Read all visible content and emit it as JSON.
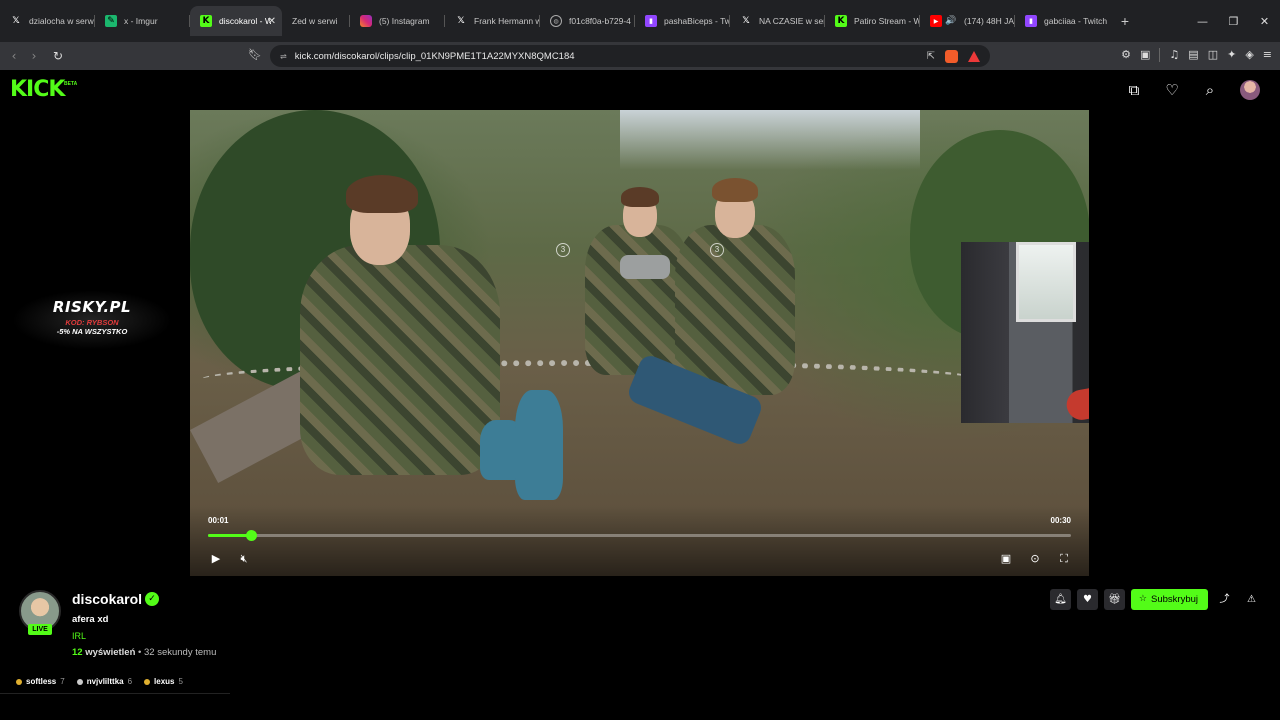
{
  "browser": {
    "tabs": [
      {
        "label": "dzialocha w serw",
        "icon": "x-icon",
        "color": "#ffffff"
      },
      {
        "label": "x - Imgur",
        "icon": "imgur-icon",
        "color": "#1bb76e"
      },
      {
        "label": "discokarol - W",
        "icon": "kick-icon",
        "color": "#53fc18",
        "active": true
      },
      {
        "label": "Zed w serwi",
        "icon": "",
        "color": ""
      },
      {
        "label": "(5) Instagram",
        "icon": "instagram-icon",
        "color": "#d62976"
      },
      {
        "label": "Frank Hermann w",
        "icon": "x-icon",
        "color": "#ffffff"
      },
      {
        "label": "f01c8f0a-b729-4",
        "icon": "globe-icon",
        "color": "#aaaaaa"
      },
      {
        "label": "pashaBiceps - Tw",
        "icon": "twitch-icon",
        "color": "#9146ff"
      },
      {
        "label": "NA CZASIE w serw",
        "icon": "x-icon",
        "color": "#ffffff"
      },
      {
        "label": "Patiro Stream - W",
        "icon": "kick-icon",
        "color": "#53fc18"
      },
      {
        "label": "(174) 48H JAI",
        "icon": "youtube-icon",
        "color": "#ff0000"
      },
      {
        "label": "gabciiaa - Twitch",
        "icon": "twitch-icon",
        "color": "#9146ff"
      }
    ],
    "url": "kick.com/discokarol/clips/clip_01KN9PME1T1A22MYXN8QMC184"
  },
  "kick": {
    "logo": "KICK",
    "beta": "BETA",
    "accent": "#53fc18"
  },
  "ad": {
    "brand": "RISKY.PL",
    "code": "KOD: RYBSON",
    "discount": "-5% NA WSZYSTKO"
  },
  "player": {
    "current_time": "00:01",
    "duration": "00:30",
    "progress": 0.05
  },
  "channel": {
    "name": "discokarol",
    "live_label": "LIVE",
    "clip_title": "afera xd",
    "category": "IRL",
    "views_count": "12",
    "views_label": "wyświetleń",
    "time_ago": "• 32 sekundy temu",
    "subscribe_label": "Subskrybuj"
  },
  "chips": [
    {
      "name": "softless",
      "count": "7",
      "color": "#e0b030"
    },
    {
      "name": "nvjvlilttka",
      "count": "6",
      "color": "#cccccc"
    },
    {
      "name": "lexus",
      "count": "5",
      "color": "#e0b030"
    }
  ]
}
